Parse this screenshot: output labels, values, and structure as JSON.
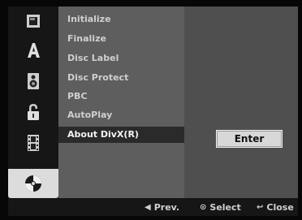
{
  "sidebar": {
    "items": [
      {
        "icon": "film-frame-icon"
      },
      {
        "icon": "letter-a-icon"
      },
      {
        "icon": "speaker-icon"
      },
      {
        "icon": "padlock-icon"
      },
      {
        "icon": "film-strip-icon"
      },
      {
        "icon": "disc-icon",
        "active": true
      }
    ]
  },
  "menu": {
    "items": [
      "Initialize",
      "Finalize",
      "Disc Label",
      "Disc Protect",
      "PBC",
      "AutoPlay",
      "About DivX(R)"
    ],
    "selected": "About DivX(R)"
  },
  "panel": {
    "enter_label": "Enter"
  },
  "footer": {
    "prev_label": "Prev.",
    "select_label": "Select",
    "close_label": "Close"
  }
}
